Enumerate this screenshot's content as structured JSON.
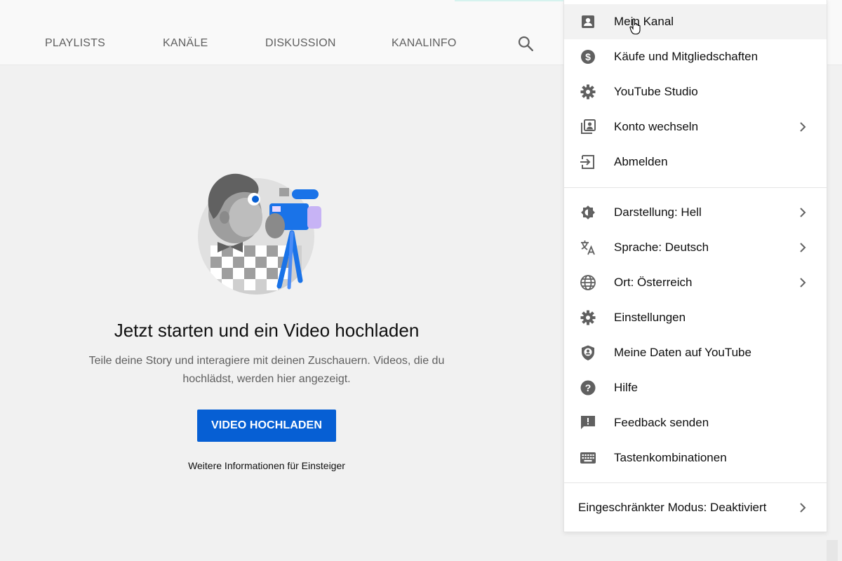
{
  "tabs": {
    "items": [
      "PLAYLISTS",
      "KANÄLE",
      "DISKUSSION",
      "KANALINFO"
    ]
  },
  "empty_state": {
    "title": "Jetzt starten und ein Video hochladen",
    "subtitle": "Teile deine Story und interagiere mit deinen Zuschauern. Videos, die du hochlädst, werden hier angezeigt.",
    "upload_label": "VIDEO HOCHLADEN",
    "more_info": "Weitere Informationen für Einsteiger"
  },
  "account_menu": {
    "section1": [
      {
        "label": "Mein Kanal",
        "icon": "account-box-icon",
        "chevron": false
      },
      {
        "label": "Käufe und Mitgliedschaften",
        "icon": "dollar-circle-icon",
        "chevron": false
      },
      {
        "label": "YouTube Studio",
        "icon": "gear-icon",
        "chevron": false
      },
      {
        "label": "Konto wechseln",
        "icon": "switch-account-icon",
        "chevron": true
      },
      {
        "label": "Abmelden",
        "icon": "sign-out-icon",
        "chevron": false
      }
    ],
    "section2": [
      {
        "label": "Darstellung: Hell",
        "icon": "appearance-icon",
        "chevron": true
      },
      {
        "label": "Sprache: Deutsch",
        "icon": "translate-icon",
        "chevron": true
      },
      {
        "label": "Ort: Österreich",
        "icon": "globe-icon",
        "chevron": true
      },
      {
        "label": "Einstellungen",
        "icon": "gear-icon",
        "chevron": false
      },
      {
        "label": "Meine Daten auf YouTube",
        "icon": "shield-person-icon",
        "chevron": false
      },
      {
        "label": "Hilfe",
        "icon": "help-icon",
        "chevron": false
      },
      {
        "label": "Feedback senden",
        "icon": "feedback-icon",
        "chevron": false
      },
      {
        "label": "Tastenkombinationen",
        "icon": "keyboard-icon",
        "chevron": false
      }
    ],
    "section3": [
      {
        "label": "Eingeschränkter Modus: Deaktiviert",
        "chevron": true
      }
    ]
  },
  "colors": {
    "primary": "#065fd4",
    "icon_gray": "#606060",
    "hover_row": "#f2f2f2"
  }
}
